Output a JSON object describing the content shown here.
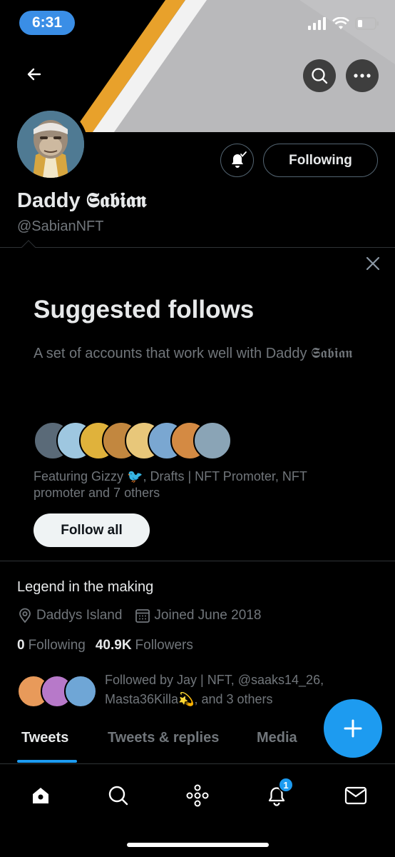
{
  "status_bar": {
    "time": "6:31"
  },
  "profile": {
    "display_name": "Daddy 𝕾𝖆𝖇𝖎𝖆𝖓",
    "handle": "@SabianNFT",
    "following_button": "Following",
    "bio": "Legend in the making",
    "location": "Daddys Island",
    "joined": "Joined June 2018",
    "following_count": "0",
    "following_label": "Following",
    "followers_count": "40.9K",
    "followers_label": "Followers",
    "followed_by": "Followed by Jay | NFT, @saaks14_26, Masta36Killa💫, and 3 others"
  },
  "suggested": {
    "title": "Suggested follows",
    "description": "A set of accounts that work well with Daddy 𝕾𝖆𝖇𝖎𝖆𝖓",
    "featuring": "Featuring Gizzy 🐦, Drafts | NFT Promoter, NFT promoter and 7 others",
    "follow_all": "Follow all"
  },
  "tabs": [
    {
      "label": "Tweets",
      "active": true
    },
    {
      "label": "Tweets & replies",
      "active": false
    },
    {
      "label": "Media",
      "active": false
    }
  ],
  "nav": {
    "notifications_badge": "1"
  },
  "colors": {
    "accent": "#1d9bf0",
    "banner_orange": "#e8a12b",
    "time_pill": "#3a8ee6"
  }
}
